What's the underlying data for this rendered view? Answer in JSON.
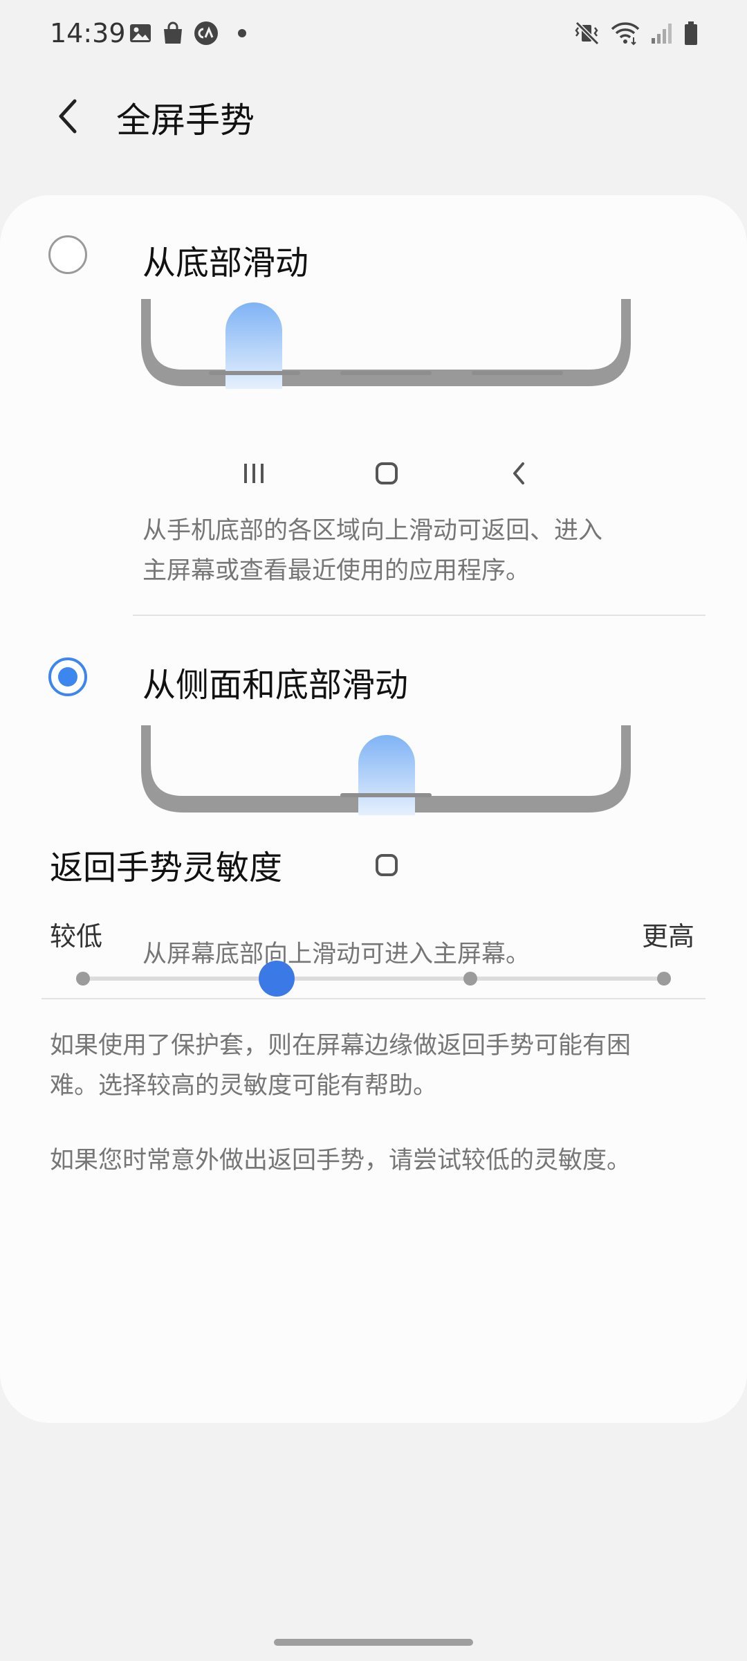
{
  "status_bar": {
    "time": "14:39",
    "left_icons": [
      "image-icon",
      "shopping-bag-icon",
      "ca-app-icon",
      "dot-icon"
    ],
    "right_icons": [
      "mute-vibrate-icon",
      "wifi-icon",
      "signal-icon",
      "battery-icon"
    ]
  },
  "header": {
    "title": "全屏手势",
    "back_icon": "chevron-left-icon"
  },
  "options": [
    {
      "label": "从底部滑动",
      "selected": false,
      "nav_icons": [
        "recents-icon",
        "home-icon",
        "back-icon"
      ],
      "description_lines": [
        "从手机底部的各区域向上滑动可返回、进入",
        "主屏幕或查看最近使用的应用程序。"
      ]
    },
    {
      "label": "从侧面和底部滑动",
      "selected": true,
      "nav_icons": [
        "home-icon"
      ],
      "description_lines": [
        "从屏幕底部向上滑动可进入主屏幕。"
      ]
    }
  ],
  "sensitivity": {
    "title": "返回手势灵敏度",
    "low_label": "较低",
    "high_label": "更高",
    "steps": 4,
    "selected_index": 1
  },
  "notes": [
    [
      "如果使用了保护套，则在屏幕边缘做返回手势可能有困",
      "难。选择较高的灵敏度可能有帮助。"
    ],
    [
      "如果您时常意外做出返回手势，请尝试较低的灵敏度。"
    ]
  ],
  "colors": {
    "accent": "#3b86ef",
    "slider_thumb": "#3b7ae6",
    "background": "#f2f2f2",
    "card": "#fcfcfc",
    "secondary_text": "#767676"
  }
}
